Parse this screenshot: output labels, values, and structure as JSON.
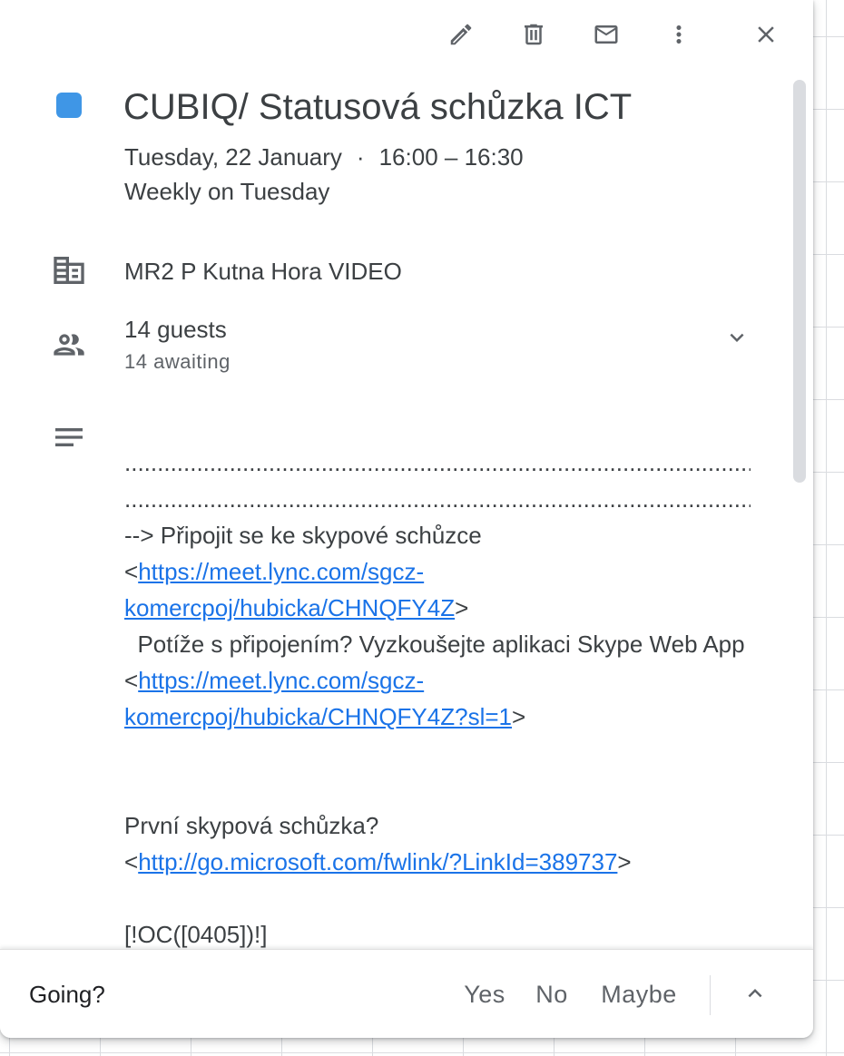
{
  "toolbar": {
    "edit_icon": "pencil-icon",
    "delete_icon": "trash-icon",
    "email_icon": "mail-icon",
    "more_icon": "more-vert-icon",
    "close_icon": "close-icon"
  },
  "event": {
    "color": "#3f96e6",
    "title": "CUBIQ/ Statusová schůzka ICT",
    "date": "Tuesday, 22 January",
    "separator": "·",
    "time": "16:00 – 16:30",
    "recurrence": "Weekly on Tuesday",
    "location": "MR2 P Kutna Hora VIDEO",
    "guests_count": "14 guests",
    "guests_status": "14 awaiting"
  },
  "description": {
    "dots_line_1": "........................................................................................................................................................................................",
    "dots_line_2": "................................................................................................",
    "join_text": "--> Připojit se ke skypové schůzce",
    "join_link": "https://meet.lync.com/sgcz-komercpoj/hubicka/CHNQFY4Z",
    "trouble_text": "  Potíže s připojením? Vyzkoušejte aplikaci Skype Web App",
    "trouble_link": "https://meet.lync.com/sgcz-komercpoj/hubicka/CHNQFY4Z?sl=1",
    "first_text": "První skypová schůzka?",
    "first_link": "http://go.microsoft.com/fwlink/?LinkId=389737",
    "code_text": "[!OC([0405])!]",
    "lt": "<",
    "gt": ">"
  },
  "footer": {
    "going_label": "Going?",
    "yes_label": "Yes",
    "no_label": "No",
    "maybe_label": "Maybe"
  }
}
